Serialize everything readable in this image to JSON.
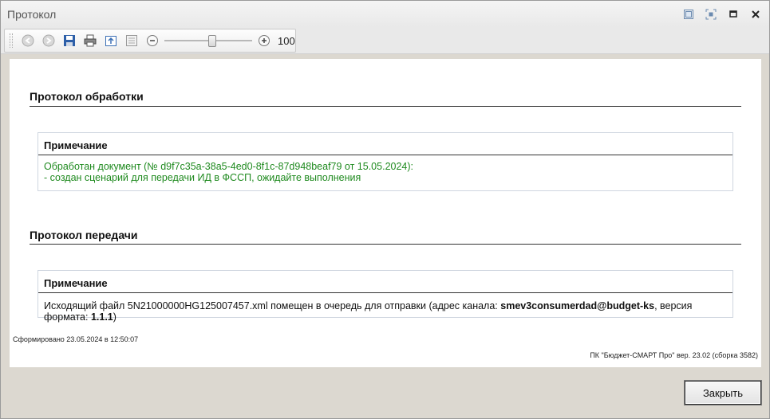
{
  "window": {
    "title": "Протокол"
  },
  "toolbar": {
    "zoom_value": "100",
    "zoom_level": 0.55
  },
  "sections": [
    {
      "title": "Протокол обработки",
      "note_header": "Примечание",
      "line1": "Обработан документ (№ d9f7c35a-38a5-4ed0-8f1c-87d948beaf79 от 15.05.2024):",
      "line2": "- создан сценарий для передачи ИД в ФССП, ожидайте выполнения"
    },
    {
      "title": "Протокол передачи",
      "note_header": "Примечание",
      "text_a": "Исходящий файл 5N21000000HG125007457.xml помещен в очередь для отправки (адрес канала: ",
      "channel": "smev3consumerdad@budget-ks",
      "text_b": ", версия формата: ",
      "format_version": "1.1.1",
      "text_c": ")"
    }
  ],
  "footer": {
    "generated": "Сформировано 23.05.2024 в 12:50:07",
    "product": "ПК \"Бюджет-СМАРТ Про\" вер. 23.02 (сборка 3582)"
  },
  "buttons": {
    "close": "Закрыть"
  },
  "colors": {
    "note_green": "#1f8a1f"
  }
}
